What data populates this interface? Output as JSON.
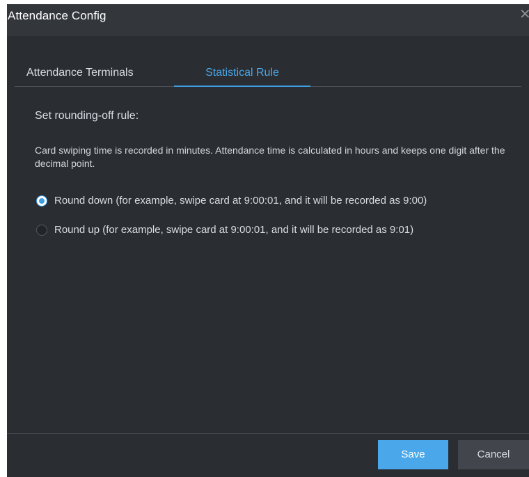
{
  "dialog": {
    "title": "Attendance Config",
    "close_icon": "close-icon",
    "close_glyph": "✕"
  },
  "tabs": [
    {
      "label": "Attendance Terminals",
      "active": false
    },
    {
      "label": "Statistical Rule",
      "active": true
    }
  ],
  "rule": {
    "heading": "Set rounding-off rule:",
    "description": "Card swiping time is recorded in minutes. Attendance time is calculated in hours and keeps one digit after the decimal point.",
    "options": [
      {
        "label": "Round down (for example, swipe card at 9:00:01, and it will be recorded as 9:00)",
        "checked": true
      },
      {
        "label": "Round up (for example, swipe card at 9:00:01, and it will be recorded as 9:01)",
        "checked": false
      }
    ]
  },
  "footer": {
    "save_label": "Save",
    "cancel_label": "Cancel"
  },
  "colors": {
    "accent": "#3f9fe4",
    "background": "#2a2d32",
    "titlebar": "#33363b"
  }
}
